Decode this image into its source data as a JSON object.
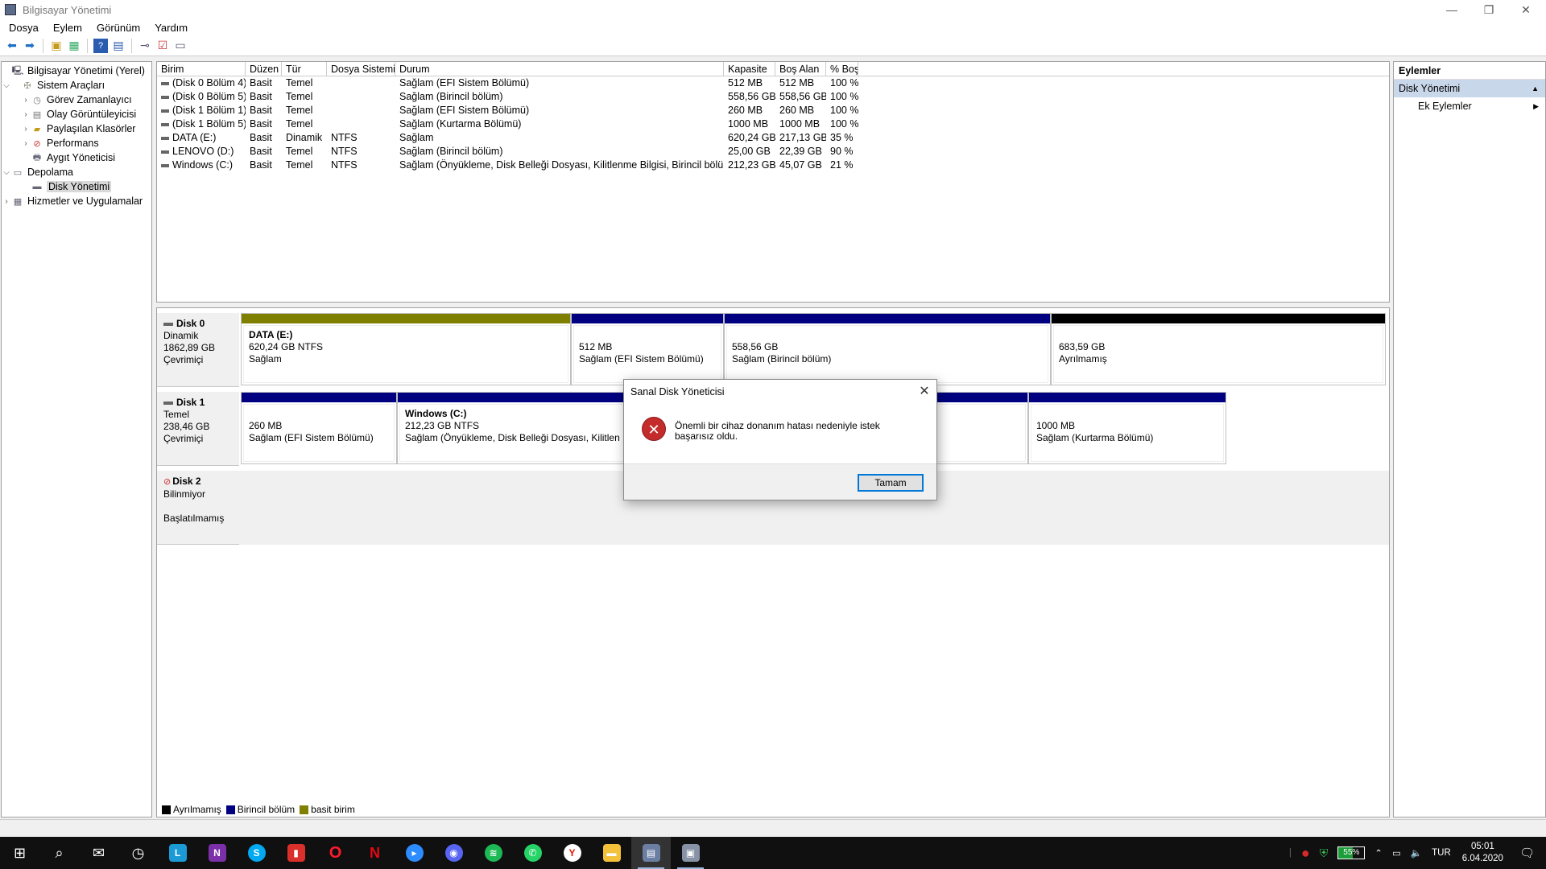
{
  "window": {
    "title": "Bilgisayar Yönetimi"
  },
  "menu": [
    "Dosya",
    "Eylem",
    "Görünüm",
    "Yardım"
  ],
  "tree": {
    "root": "Bilgisayar Yönetimi (Yerel)",
    "system_tools": "Sistem Araçları",
    "task_scheduler": "Görev Zamanlayıcı",
    "event_viewer": "Olay Görüntüleyicisi",
    "shared_folders": "Paylaşılan Klasörler",
    "performance": "Performans",
    "device_manager": "Aygıt Yöneticisi",
    "storage": "Depolama",
    "disk_management": "Disk Yönetimi",
    "services": "Hizmetler ve Uygulamalar"
  },
  "volumes": {
    "headers": [
      "Birim",
      "Düzen",
      "Tür",
      "Dosya Sistemi",
      "Durum",
      "Kapasite",
      "Boş Alan",
      "% Boş"
    ],
    "rows": [
      [
        "(Disk 0 Bölüm 4)",
        "Basit",
        "Temel",
        "",
        "Sağlam (EFI Sistem Bölümü)",
        "512 MB",
        "512 MB",
        "100 %"
      ],
      [
        "(Disk 0 Bölüm 5)",
        "Basit",
        "Temel",
        "",
        "Sağlam (Birincil bölüm)",
        "558,56 GB",
        "558,56 GB",
        "100 %"
      ],
      [
        "(Disk 1 Bölüm 1)",
        "Basit",
        "Temel",
        "",
        "Sağlam (EFI Sistem Bölümü)",
        "260 MB",
        "260 MB",
        "100 %"
      ],
      [
        "(Disk 1 Bölüm 5)",
        "Basit",
        "Temel",
        "",
        "Sağlam (Kurtarma Bölümü)",
        "1000 MB",
        "1000 MB",
        "100 %"
      ],
      [
        "DATA (E:)",
        "Basit",
        "Dinamik",
        "NTFS",
        "Sağlam",
        "620,24 GB",
        "217,13 GB",
        "35 %"
      ],
      [
        "LENOVO (D:)",
        "Basit",
        "Temel",
        "NTFS",
        "Sağlam (Birincil bölüm)",
        "25,00 GB",
        "22,39 GB",
        "90 %"
      ],
      [
        "Windows (C:)",
        "Basit",
        "Temel",
        "NTFS",
        "Sağlam (Önyükleme, Disk Belleği Dosyası, Kilitlenme Bilgisi, Birincil bölüm)",
        "212,23 GB",
        "45,07 GB",
        "21 %"
      ]
    ]
  },
  "disks": {
    "disk0": {
      "name": "Disk 0",
      "type": "Dinamik",
      "size": "1862,89 GB",
      "status": "Çevrimiçi",
      "p1": {
        "name": "DATA  (E:)",
        "size": "620,24 GB NTFS",
        "status": "Sağlam"
      },
      "p2": {
        "size": "512 MB",
        "status": "Sağlam (EFI Sistem Bölümü)"
      },
      "p3": {
        "size": "558,56 GB",
        "status": "Sağlam (Birincil bölüm)"
      },
      "p4": {
        "size": "683,59 GB",
        "status": "Ayrılmamış"
      }
    },
    "disk1": {
      "name": "Disk 1",
      "type": "Temel",
      "size": "238,46 GB",
      "status": "Çevrimiçi",
      "p1": {
        "size": "260 MB",
        "status": "Sağlam (EFI Sistem Bölümü)"
      },
      "p2": {
        "name": "Windows  (C:)",
        "size": "212,23 GB NTFS",
        "status": "Sağlam (Önyükleme, Disk Belleği Dosyası, Kilitlen"
      },
      "p4": {
        "size": "1000 MB",
        "status": "Sağlam (Kurtarma Bölümü)"
      }
    },
    "disk2": {
      "name": "Disk 2",
      "type": "Bilinmiyor",
      "status": "Başlatılmamış"
    }
  },
  "legend": [
    "Ayrılmamış",
    "Birincil bölüm",
    "basit birim"
  ],
  "colors": {
    "unallocated": "#000000",
    "primary": "#000080",
    "simple": "#808000"
  },
  "actions": {
    "header": "Eylemler",
    "section": "Disk Yönetimi",
    "more": "Ek Eylemler"
  },
  "dialog": {
    "title": "Sanal Disk Yöneticisi",
    "message": "Önemli bir cihaz donanım hatası nedeniyle istek başarısız oldu.",
    "ok": "Tamam"
  },
  "tray": {
    "battery": "55%",
    "lang": "TUR",
    "time": "05:01",
    "date": "6.04.2020"
  }
}
